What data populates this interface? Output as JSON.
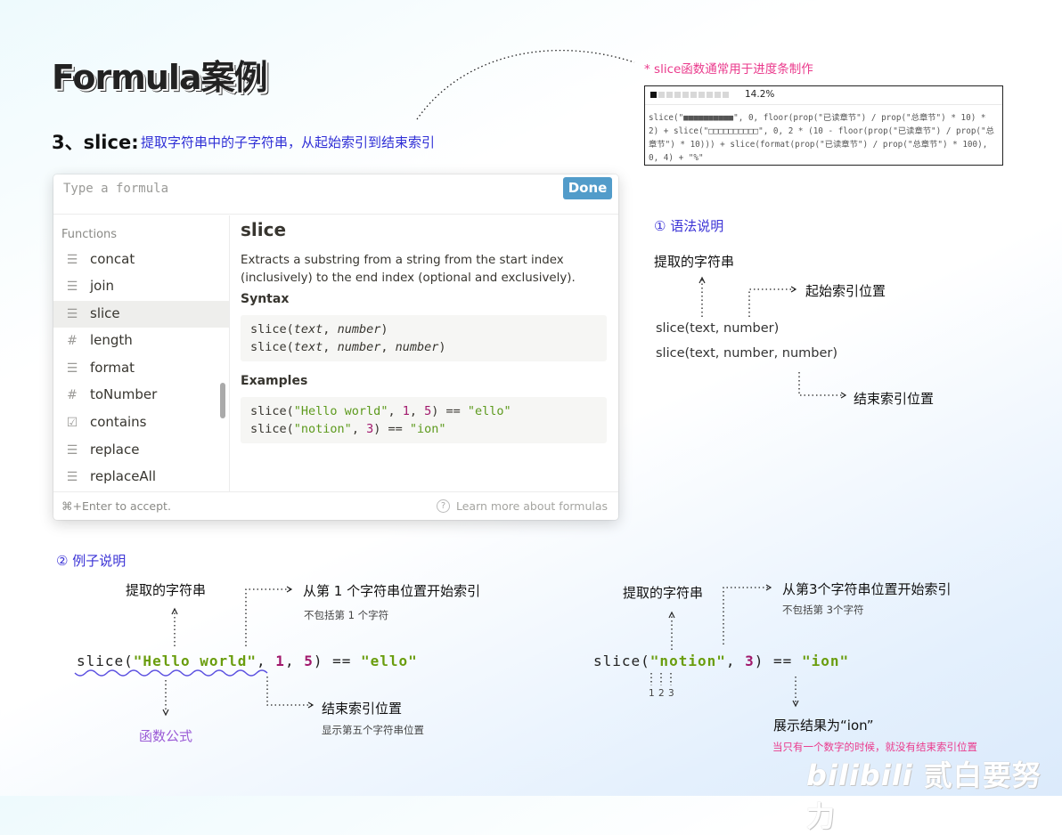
{
  "page": {
    "title": "Formula案例",
    "section_number": "3、slice:",
    "section_desc": "提取字符串中的子字符串，从起始索引到结束索引"
  },
  "formula_window": {
    "placeholder": "Type a formula",
    "done_label": "Done",
    "functions_header": "Functions",
    "functions": [
      {
        "label": "concat",
        "icon": "text-lines-icon"
      },
      {
        "label": "join",
        "icon": "text-lines-icon"
      },
      {
        "label": "slice",
        "icon": "text-lines-icon",
        "selected": true
      },
      {
        "label": "length",
        "icon": "hash-icon"
      },
      {
        "label": "format",
        "icon": "text-lines-icon"
      },
      {
        "label": "toNumber",
        "icon": "hash-icon"
      },
      {
        "label": "contains",
        "icon": "checkbox-icon"
      },
      {
        "label": "replace",
        "icon": "text-lines-icon"
      },
      {
        "label": "replaceAll",
        "icon": "text-lines-icon"
      }
    ],
    "detail": {
      "name": "slice",
      "description": "Extracts a substring from a string from the start index (inclusively) to the end index (optional and exclusively).",
      "syntax_header": "Syntax",
      "examples_header": "Examples"
    },
    "footer_hint": "⌘+Enter to accept.",
    "learn_more": "Learn more about formulas"
  },
  "progress_note": {
    "title": "* slice函数通常用于进度条制作",
    "percent": "14.2%",
    "filled_cells": 1,
    "total_cells": 10,
    "code": "slice(\"■■■■■■■■■■\", 0, floor(prop(\"已读章节\") / prop(\"总章节\") * 10) * 2) + slice(\"□□□□□□□□□□\", 0, 2 * (10 - floor(prop(\"已读章节\") / prop(\"总章节\") * 10))) + slice(format(prop(\"已读章节\") / prop(\"总章节\") * 100), 0, 4) + \"%\""
  },
  "syntax_notes": {
    "heading": "① 语法说明",
    "extract_label": "提取的字符串",
    "start_label": "起始索引位置",
    "syntax1": "slice(text, number)",
    "syntax2": "slice(text, number, number)",
    "end_label": "结束索引位置"
  },
  "example_notes": {
    "heading": "② 例子说明",
    "ex1": {
      "extract_label": "提取的字符串",
      "start_label": "从第 1 个字符串位置开始索引",
      "start_sub": "不包括第 1 个字符",
      "end_label": "结束索引位置",
      "end_sub": "显示第五个字符串位置",
      "formula_label": "函数公式"
    },
    "ex2": {
      "extract_label": "提取的字符串",
      "start_label": "从第3个字符串位置开始索引",
      "start_sub": "不包括第 3个字符",
      "idx1": "1",
      "idx2": "2",
      "idx3": "3",
      "result_label": "展示结果为“ion”",
      "result_sub": "当只有一个数字的时候，就没有结束索引位置"
    }
  },
  "watermark": "贰白要努力"
}
